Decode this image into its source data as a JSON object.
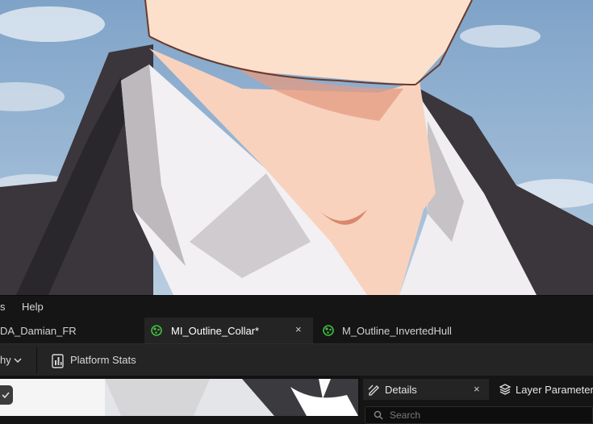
{
  "menu": {
    "items": [
      {
        "label": "s"
      },
      {
        "label": "Help"
      }
    ]
  },
  "tabs": [
    {
      "label": "DA_Damian_FR",
      "active": false
    },
    {
      "label": "MI_Outline_Collar*",
      "active": true,
      "icon": "material-instance-icon",
      "close": "×"
    },
    {
      "label": "M_Outline_InvertedHull",
      "active": false,
      "icon": "material-icon"
    }
  ],
  "toolbar": {
    "hierarchy_label": "hy",
    "platform_stats_label": "Platform Stats"
  },
  "details_panel": {
    "tabs": [
      {
        "label": "Details",
        "close": "×",
        "icon": "details-pencil-icon"
      },
      {
        "label": "Layer Parameters",
        "icon": "layers-icon"
      }
    ],
    "search_placeholder": "Search"
  },
  "colors": {
    "active_tab": "#242424",
    "material_icon": "#3fbf3f",
    "background": "#151515"
  }
}
